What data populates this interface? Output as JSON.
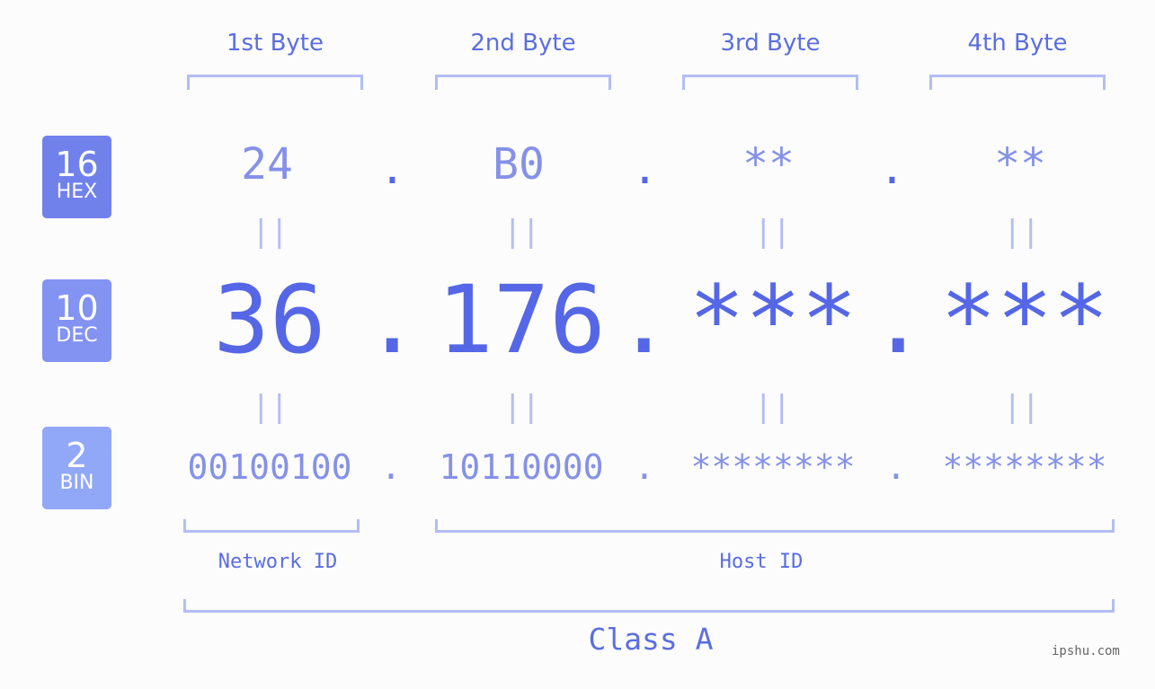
{
  "byte_headers": [
    "1st Byte",
    "2nd Byte",
    "3rd Byte",
    "4th Byte"
  ],
  "badges": [
    {
      "num": "16",
      "label": "HEX",
      "color": "#7181ec"
    },
    {
      "num": "10",
      "label": "DEC",
      "color": "#8393f2"
    },
    {
      "num": "2",
      "label": "BIN",
      "color": "#91a8f8"
    }
  ],
  "hex": [
    "24",
    "B0",
    "**",
    "**"
  ],
  "dec": [
    "36",
    "176",
    "***",
    "***"
  ],
  "bin": [
    "00100100",
    "10110000",
    "********",
    "********"
  ],
  "separator": ".",
  "equals": "||",
  "network_label": "Network ID",
  "host_label": "Host ID",
  "class_label": "Class A",
  "watermark": "ipshu.com"
}
